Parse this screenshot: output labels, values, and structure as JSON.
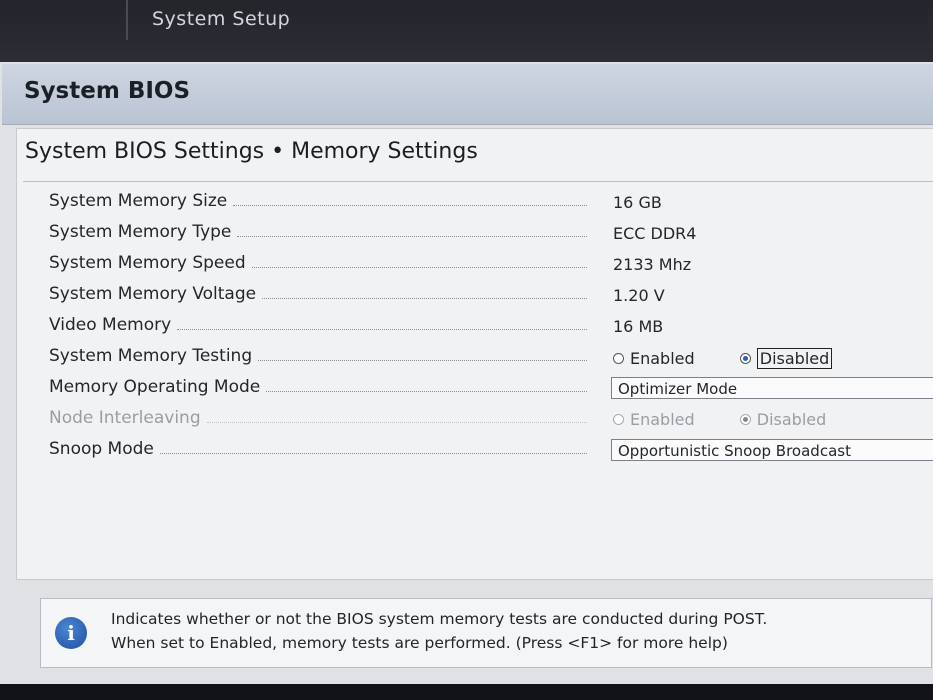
{
  "window": {
    "title": "System Setup"
  },
  "header": {
    "title": "System BIOS"
  },
  "page": {
    "title": "System BIOS Settings • Memory Settings"
  },
  "settings": [
    {
      "label": "System Memory Size",
      "value": "16 GB"
    },
    {
      "label": "System Memory Type",
      "value": "ECC DDR4"
    },
    {
      "label": "System Memory Speed",
      "value": "2133 Mhz"
    },
    {
      "label": "System Memory Voltage",
      "value": "1.20 V"
    },
    {
      "label": "Video Memory",
      "value": "16 MB"
    },
    {
      "label": "System Memory Testing",
      "options": [
        "Enabled",
        "Disabled"
      ],
      "selected": "Disabled"
    },
    {
      "label": "Memory Operating Mode",
      "value": "Optimizer Mode"
    },
    {
      "label": "Node Interleaving",
      "options": [
        "Enabled",
        "Disabled"
      ],
      "selected": "Disabled",
      "disabled": true
    },
    {
      "label": "Snoop Mode",
      "value": "Opportunistic Snoop Broadcast"
    }
  ],
  "help": {
    "icon": "info-icon",
    "line1": "Indicates whether or not the BIOS system memory tests are conducted during POST.",
    "line2": "When set to Enabled, memory tests are performed. (Press <F1> for more help)"
  }
}
